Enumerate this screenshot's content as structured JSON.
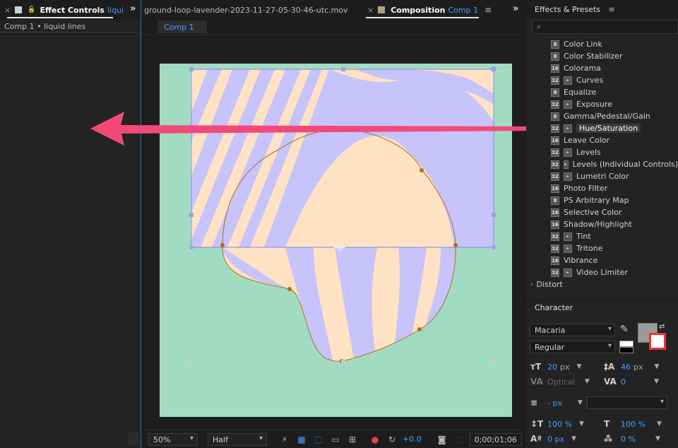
{
  "effect_controls": {
    "tab_title": "Effect Controls",
    "tab_layer": "liqui",
    "subtitle": "Comp 1 • liquid lines",
    "expand": "»"
  },
  "footage_tab": {
    "title": "ground-loop-lavender-2023-11-27-05-30-46-utc.mov"
  },
  "composition": {
    "tab_title": "Composition",
    "tab_comp": "Comp 1",
    "chip": "Comp 1",
    "expand": "»",
    "menu": "≡"
  },
  "viewer": {
    "bg_color": "#1e1e1e",
    "comp_bg": "#a1dcc2",
    "stripe_a": "#ffe2c4",
    "stripe_b": "#c7c3fb",
    "bbox_color": "#7f86e0",
    "mask_color": "#b26f15",
    "arrow_color": "#f24a78"
  },
  "bottom_bar": {
    "zoom": "50%",
    "resolution": "Half",
    "exposure": "+0.0",
    "timecode": "0;00;01;06"
  },
  "effects_presets": {
    "title": "Effects & Presets",
    "search_placeholder": "⌕",
    "items": [
      {
        "label": "Color Link",
        "bits": "8"
      },
      {
        "label": "Color Stabilizer",
        "bits": "8"
      },
      {
        "label": "Colorama",
        "bits": "16"
      },
      {
        "label": "Curves",
        "bits": "32"
      },
      {
        "label": "Equalize",
        "bits": "8"
      },
      {
        "label": "Exposure",
        "bits": "32"
      },
      {
        "label": "Gamma/Pedestal/Gain",
        "bits": "8"
      },
      {
        "label": "Hue/Saturation",
        "bits": "32"
      },
      {
        "label": "Leave Color",
        "bits": "16"
      },
      {
        "label": "Levels",
        "bits": "32"
      },
      {
        "label": "Levels (Individual Controls)",
        "bits": "32"
      },
      {
        "label": "Lumetri Color",
        "bits": "32"
      },
      {
        "label": "Photo Filter",
        "bits": "16"
      },
      {
        "label": "PS Arbitrary Map",
        "bits": "8"
      },
      {
        "label": "Selective Color",
        "bits": "16"
      },
      {
        "label": "Shadow/Highlight",
        "bits": "16"
      },
      {
        "label": "Tint",
        "bits": "32"
      },
      {
        "label": "Tritone",
        "bits": "32"
      },
      {
        "label": "Vibrance",
        "bits": "16"
      },
      {
        "label": "Video Limiter",
        "bits": "32"
      }
    ],
    "selected": "Hue/Saturation",
    "category": "Distort"
  },
  "character": {
    "title": "Character",
    "font": "Macaria",
    "style": "Regular",
    "font_size": "20",
    "font_size_unit": "px",
    "leading": "46",
    "leading_unit": "px",
    "kerning": "Optical",
    "tracking": "0",
    "stroke_width": "- px",
    "vert_scale": "100 %",
    "horiz_scale": "100 %",
    "baseline_shift": "0 px",
    "tsume": "0 %",
    "fill_color": "#9a9a9a"
  }
}
